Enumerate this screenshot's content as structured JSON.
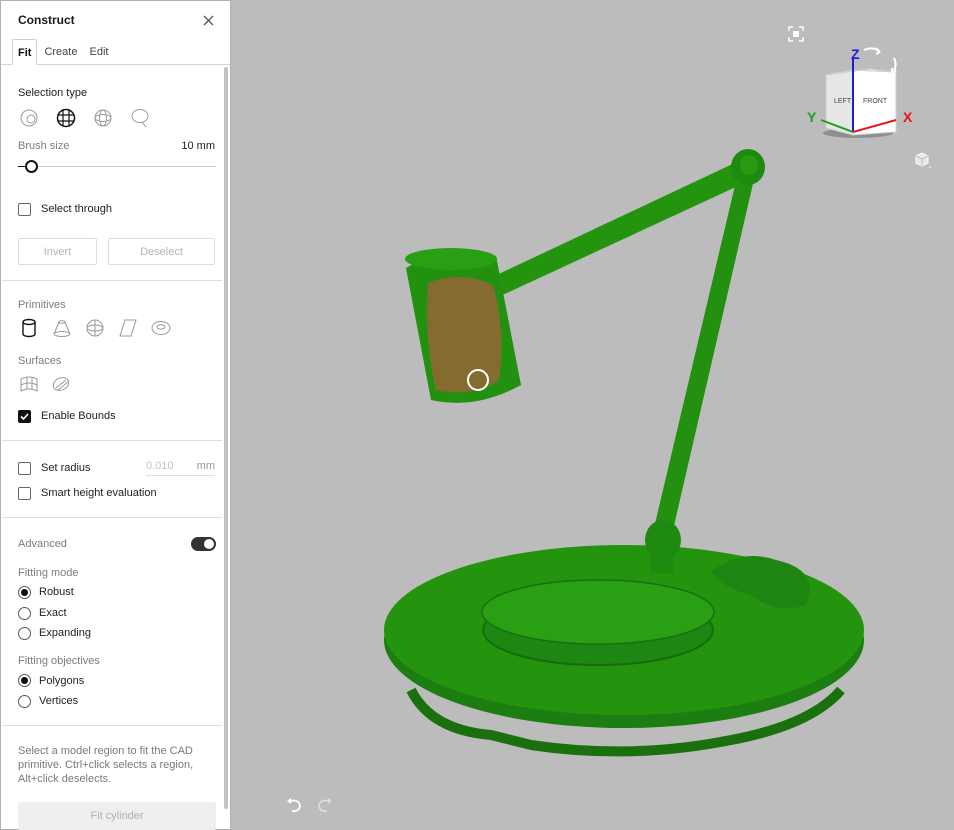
{
  "panel": {
    "title": "Construct",
    "tabs": [
      {
        "label": "Fit",
        "active": true
      },
      {
        "label": "Create",
        "active": false
      },
      {
        "label": "Edit",
        "active": false
      }
    ],
    "selection_type_label": "Selection type",
    "selection_tools": [
      "lasso-select-icon",
      "grid-select-icon",
      "sphere-select-icon",
      "speech-lasso-icon"
    ],
    "brush_size_label": "Brush size",
    "brush_size_value": "10 mm",
    "brush_slider_fraction": 0.06,
    "select_through_label": "Select through",
    "select_through_checked": false,
    "invert_label": "Invert",
    "deselect_label": "Deselect",
    "primitives_label": "Primitives",
    "primitive_tools": [
      "cylinder-icon",
      "cone-icon",
      "sphere-icon",
      "plane-icon",
      "torus-icon"
    ],
    "surfaces_label": "Surfaces",
    "surface_tools": [
      "freeform-surface-icon",
      "extrusion-surface-icon"
    ],
    "enable_bounds_label": "Enable Bounds",
    "enable_bounds_checked": true,
    "set_radius_label": "Set radius",
    "set_radius_checked": false,
    "radius_value": "0.010",
    "radius_unit": "mm",
    "smart_height_label": "Smart height evaluation",
    "smart_height_checked": false,
    "advanced_label": "Advanced",
    "advanced_on": true,
    "fitting_mode_label": "Fitting mode",
    "fitting_modes": [
      {
        "label": "Robust",
        "checked": true
      },
      {
        "label": "Exact",
        "checked": false
      },
      {
        "label": "Expanding",
        "checked": false
      }
    ],
    "fitting_objectives_label": "Fitting objectives",
    "fitting_objectives": [
      {
        "label": "Polygons",
        "checked": true
      },
      {
        "label": "Vertices",
        "checked": false
      }
    ],
    "help_text": "Select a model region to fit the CAD primitive. Ctrl+click selects a region, Alt+click deselects.",
    "fit_button_label": "Fit cylinder"
  },
  "viewport": {
    "view_cube": {
      "front": "FRONT",
      "left": "LEFT"
    },
    "axes": {
      "x": "X",
      "y": "Y",
      "z": "Z"
    },
    "colors": {
      "x": "#e8141b",
      "y": "#1aa31a",
      "z": "#1c1cd9",
      "model": "#1e8a12",
      "selection": "#a0603a",
      "background": "#bcbcbc"
    }
  }
}
